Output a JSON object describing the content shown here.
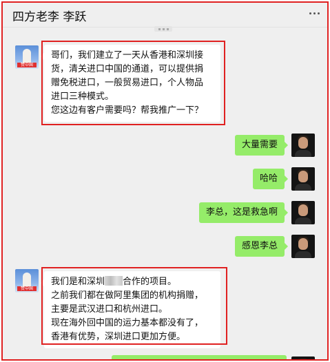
{
  "chat": {
    "title": "四方老李 李跃",
    "more_icon": "more-dots-icon"
  },
  "avatars": {
    "contact_tag": "赞中国"
  },
  "messages": [
    {
      "side": "left",
      "highlighted": true,
      "lines": [
        "哥们，我们建立了一天从香港和深圳接",
        "货，清关进口中国的通道，可以提供捐",
        "赠免税进口，一般贸易进口，个人物品",
        "进口三种模式。",
        "您这边有客户需要吗？帮我推广一下？"
      ]
    },
    {
      "side": "right",
      "text": "大量需要"
    },
    {
      "side": "right",
      "text": "哈哈"
    },
    {
      "side": "right",
      "text": "李总，这是救急啊"
    },
    {
      "side": "right",
      "text": "感恩李总"
    },
    {
      "side": "left",
      "highlighted": true,
      "lines": [
        "我们是和深圳",
        "合作的项目。",
        "之前我们都在做阿里集团的机构捐赠，",
        "主要是武汉进口和杭州进口。",
        "现在海外回中国的运力基本都没有了，",
        "香港有优势，深圳进口更加方便。"
      ]
    }
  ]
}
